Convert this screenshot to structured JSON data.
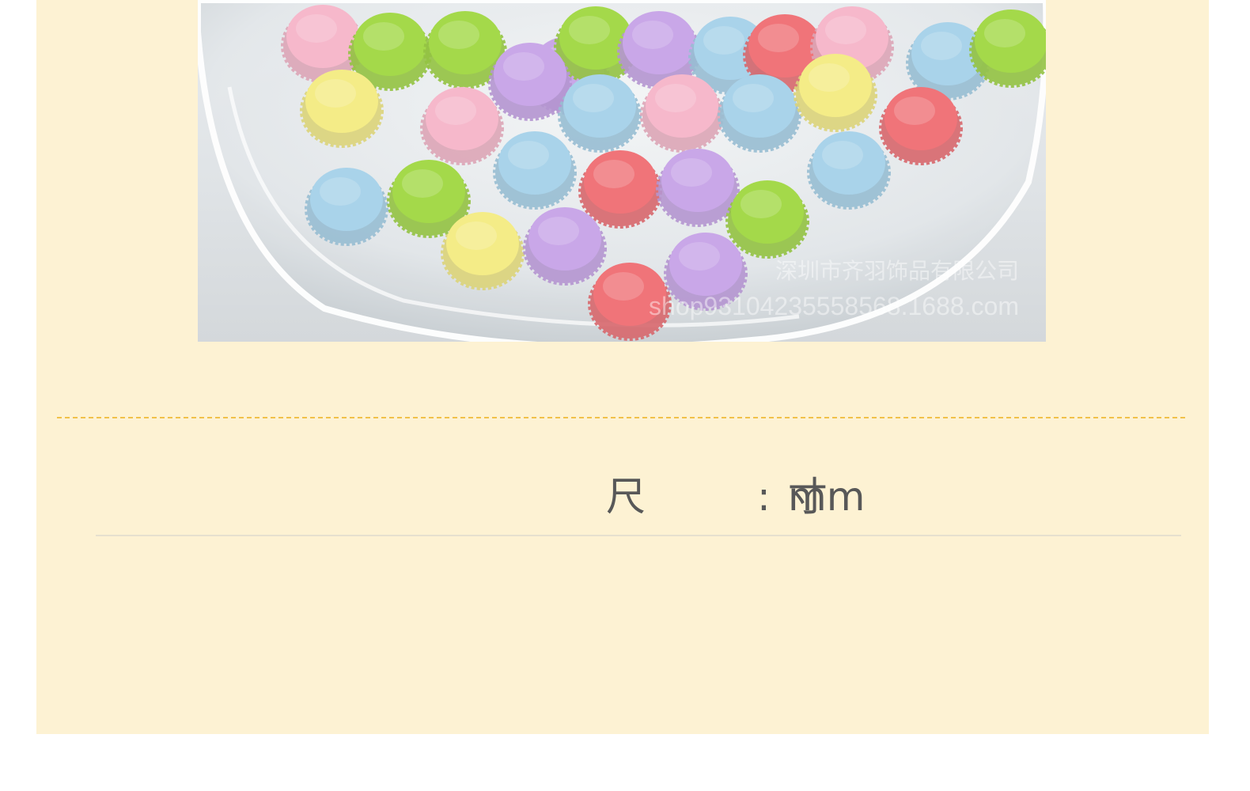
{
  "product_photo": {
    "watermark_company": "深圳市齐羽饰品有限公司",
    "watermark_url": "shop93104235558568.1688.com"
  },
  "size_spec": {
    "label": "尺 寸",
    "colon": ":",
    "unit": "mm"
  },
  "colors": {
    "panel_background": "#fdf2d3",
    "dashed_divider": "#f1c14a",
    "text": "#585858",
    "bead_colors": [
      "#a4d94a",
      "#c9a7e8",
      "#a9d3ea",
      "#f6b8cb",
      "#f07479",
      "#f4ec87"
    ]
  }
}
